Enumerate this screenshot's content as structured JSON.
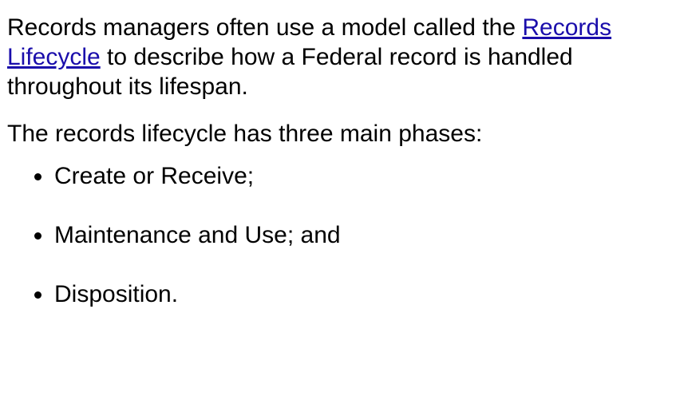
{
  "intro": {
    "before_link": "Records managers often use a model called the ",
    "link_text": "Records Lifecycle",
    "after_link": " to describe how a Federal record is handled throughout its lifespan."
  },
  "phases_intro": "The records lifecycle has three main phases:",
  "phases": [
    "Create or Receive;",
    "Maintenance and Use; and",
    "Disposition."
  ],
  "colors": {
    "link": "#1a0dab",
    "text": "#000000"
  }
}
